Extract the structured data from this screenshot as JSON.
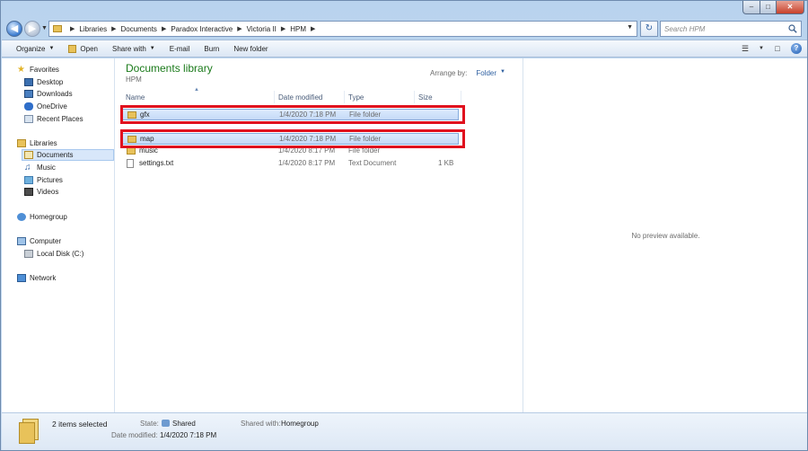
{
  "address": {
    "crumbs": [
      "Libraries",
      "Documents",
      "Paradox Interactive",
      "Victoria II",
      "HPM"
    ]
  },
  "search": {
    "placeholder": "Search HPM"
  },
  "toolbar": {
    "organize": "Organize",
    "open": "Open",
    "share_with": "Share with",
    "email": "E-mail",
    "burn": "Burn",
    "new_folder": "New folder"
  },
  "nav": {
    "favorites": "Favorites",
    "desktop": "Desktop",
    "downloads": "Downloads",
    "onedrive": "OneDrive",
    "recent": "Recent Places",
    "libraries": "Libraries",
    "documents": "Documents",
    "music": "Music",
    "pictures": "Pictures",
    "videos": "Videos",
    "homegroup": "Homegroup",
    "computer": "Computer",
    "local_disk": "Local Disk (C:)",
    "network": "Network"
  },
  "library": {
    "title": "Documents library",
    "subtitle": "HPM",
    "arrange_label": "Arrange by:",
    "arrange_value": "Folder"
  },
  "columns": {
    "name": "Name",
    "date": "Date modified",
    "type": "Type",
    "size": "Size"
  },
  "files": [
    {
      "name": "gfx",
      "date": "1/4/2020 7:18 PM",
      "type": "File folder",
      "size": ""
    },
    {
      "name": "map",
      "date": "1/4/2020 7:18 PM",
      "type": "File folder",
      "size": ""
    },
    {
      "name": "music",
      "date": "1/4/2020 8:17 PM",
      "type": "File folder",
      "size": ""
    },
    {
      "name": "settings.txt",
      "date": "1/4/2020 8:17 PM",
      "type": "Text Document",
      "size": "1 KB"
    }
  ],
  "preview": {
    "message": "No preview available."
  },
  "details": {
    "count": "2 items selected",
    "state_label": "State:",
    "state_value": "Shared",
    "shared_label": "Shared with:",
    "shared_value": "Homegroup",
    "date_label": "Date modified:",
    "date_value": "1/4/2020 7:18 PM"
  },
  "colors": {
    "highlight": "#e0101e",
    "library_title": "#1a7a1a"
  }
}
